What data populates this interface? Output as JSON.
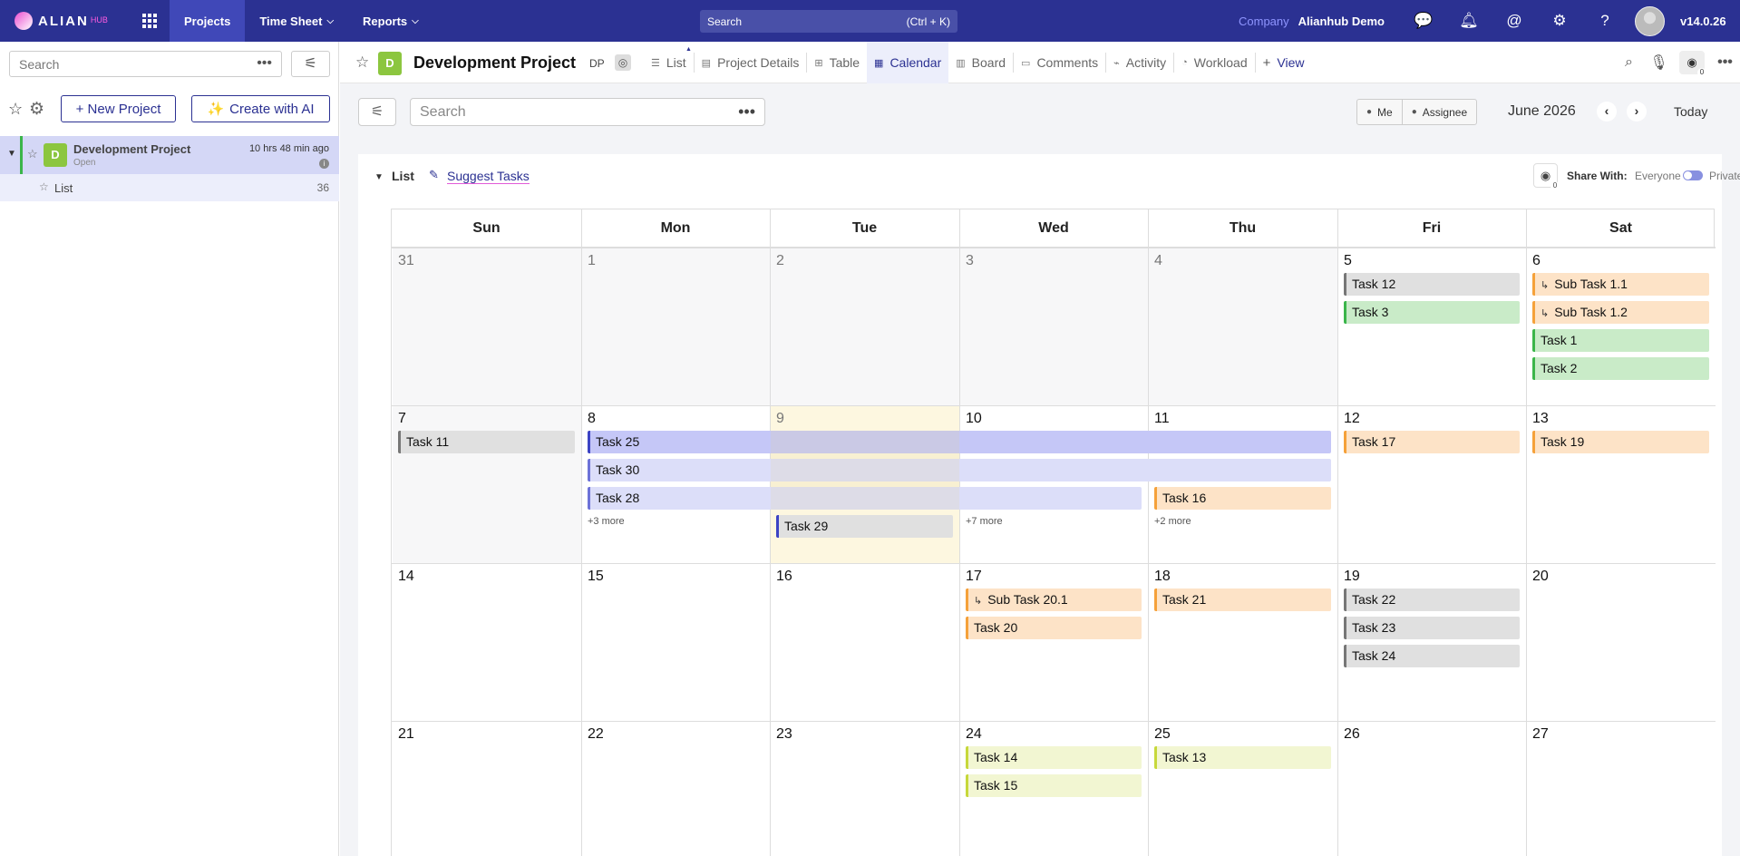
{
  "topnav": {
    "logo": "ALIAN",
    "logo_sub": "HUB",
    "items": [
      {
        "label": "Projects"
      },
      {
        "label": "Time Sheet"
      },
      {
        "label": "Reports"
      }
    ],
    "search_label": "Search",
    "search_shortcut": "(Ctrl + K)",
    "company_label": "Company",
    "company_name": "Alianhub Demo",
    "version": "v14.0.26",
    "icons": [
      "chat-icon",
      "bell-icon",
      "mention-icon",
      "integrations-icon",
      "help-icon"
    ]
  },
  "sidebar": {
    "search_placeholder": "Search",
    "new_project": "+ New Project",
    "create_ai": "Create with AI",
    "project": {
      "initial": "D",
      "name": "Development Project",
      "status": "Open",
      "time": "10 hrs 48 min ago"
    },
    "list": {
      "name": "List",
      "count": "36"
    }
  },
  "header": {
    "initial": "D",
    "title": "Development Project",
    "code": "DP",
    "tabs": [
      {
        "label": "List",
        "icon": "list-icon"
      },
      {
        "label": "Project Details",
        "icon": "details-icon"
      },
      {
        "label": "Table",
        "icon": "table-icon"
      },
      {
        "label": "Calendar",
        "icon": "calendar-icon"
      },
      {
        "label": "Board",
        "icon": "board-icon"
      },
      {
        "label": "Comments",
        "icon": "comment-icon"
      },
      {
        "label": "Activity",
        "icon": "activity-icon"
      },
      {
        "label": "Workload",
        "icon": "workload-icon"
      },
      {
        "label": "View",
        "icon": "plus-icon"
      }
    ],
    "watch_count": "0"
  },
  "toolbar": {
    "search_placeholder": "Search",
    "me": "Me",
    "assignee": "Assignee",
    "month": "June 2026",
    "today": "Today"
  },
  "card": {
    "title": "List",
    "suggest": "Suggest Tasks",
    "watch_count": "0",
    "share_with": "Share With:",
    "everyone": "Everyone",
    "private": "Private"
  },
  "calendar": {
    "days": [
      "Sun",
      "Mon",
      "Tue",
      "Wed",
      "Thu",
      "Fri",
      "Sat"
    ],
    "weeks": [
      [
        "31",
        "1",
        "2",
        "3",
        "4",
        "5",
        "6"
      ],
      [
        "7",
        "8",
        "9",
        "10",
        "11",
        "12",
        "13"
      ],
      [
        "14",
        "15",
        "16",
        "17",
        "18",
        "19",
        "20"
      ],
      [
        "21",
        "22",
        "23",
        "24",
        "25",
        "26",
        "27"
      ]
    ],
    "colors": {
      "gray_bg": "#e0e0e0",
      "gray_bar": "#777777",
      "orange_bg": "#fde3c7",
      "orange_bar": "#f5a13a",
      "green_bg": "#c9ebc8",
      "green_bar": "#3bb54a",
      "purple_bg": "#c5c7f7",
      "purple_bar": "#3c43c4",
      "lav_bg": "#dcdef9",
      "lav_bar": "#6d72d8",
      "yellow_bg": "#f2f6d2",
      "yellow_bar": "#c7d83b",
      "today_bg": "#fdf7e0"
    },
    "events": [
      {
        "label": "Task 12",
        "week": 0,
        "day": 5,
        "span": 1,
        "row": 0,
        "color": "gray"
      },
      {
        "label": "Task 3",
        "week": 0,
        "day": 5,
        "span": 1,
        "row": 1,
        "color": "green"
      },
      {
        "label": "Sub Task 1.1",
        "week": 0,
        "day": 6,
        "span": 1,
        "row": 0,
        "color": "orange",
        "subtask": true
      },
      {
        "label": "Sub Task 1.2",
        "week": 0,
        "day": 6,
        "span": 1,
        "row": 1,
        "color": "orange",
        "subtask": true
      },
      {
        "label": "Task 1",
        "week": 0,
        "day": 6,
        "span": 1,
        "row": 2,
        "color": "green"
      },
      {
        "label": "Task 2",
        "week": 0,
        "day": 6,
        "span": 1,
        "row": 3,
        "color": "green"
      },
      {
        "label": "Task 11",
        "week": 1,
        "day": 0,
        "span": 1,
        "row": 0,
        "color": "gray"
      },
      {
        "label": "Task 25",
        "week": 1,
        "day": 1,
        "span": 4,
        "row": 0,
        "color": "purple"
      },
      {
        "label": "Task 30",
        "week": 1,
        "day": 1,
        "span": 4,
        "row": 1,
        "color": "lav"
      },
      {
        "label": "Task 28",
        "week": 1,
        "day": 1,
        "span": 3,
        "row": 2,
        "color": "lav"
      },
      {
        "label": "Task 16",
        "week": 1,
        "day": 4,
        "span": 1,
        "row": 2,
        "color": "orange"
      },
      {
        "label": "Task 29",
        "week": 1,
        "day": 2,
        "span": 1,
        "row": 3,
        "color": "gray_blue"
      },
      {
        "label": "Task 17",
        "week": 1,
        "day": 5,
        "span": 1,
        "row": 0,
        "color": "orange"
      },
      {
        "label": "Task 19",
        "week": 1,
        "day": 6,
        "span": 1,
        "row": 0,
        "color": "orange"
      },
      {
        "label": "Sub Task 20.1",
        "week": 2,
        "day": 3,
        "span": 1,
        "row": 0,
        "color": "orange",
        "subtask": true
      },
      {
        "label": "Task 20",
        "week": 2,
        "day": 3,
        "span": 1,
        "row": 1,
        "color": "orange"
      },
      {
        "label": "Task 21",
        "week": 2,
        "day": 4,
        "span": 1,
        "row": 0,
        "color": "orange"
      },
      {
        "label": "Task 22",
        "week": 2,
        "day": 5,
        "span": 1,
        "row": 0,
        "color": "gray"
      },
      {
        "label": "Task 23",
        "week": 2,
        "day": 5,
        "span": 1,
        "row": 1,
        "color": "gray"
      },
      {
        "label": "Task 24",
        "week": 2,
        "day": 5,
        "span": 1,
        "row": 2,
        "color": "gray"
      },
      {
        "label": "Task 14",
        "week": 3,
        "day": 3,
        "span": 1,
        "row": 0,
        "color": "yellow"
      },
      {
        "label": "Task 15",
        "week": 3,
        "day": 3,
        "span": 1,
        "row": 1,
        "color": "yellow"
      },
      {
        "label": "Task 13",
        "week": 3,
        "day": 4,
        "span": 1,
        "row": 0,
        "color": "yellow"
      }
    ],
    "more": [
      {
        "label": "+3 more",
        "week": 1,
        "day": 1
      },
      {
        "label": "+7 more",
        "week": 1,
        "day": 3
      },
      {
        "label": "+2 more",
        "week": 1,
        "day": 4
      }
    ]
  }
}
